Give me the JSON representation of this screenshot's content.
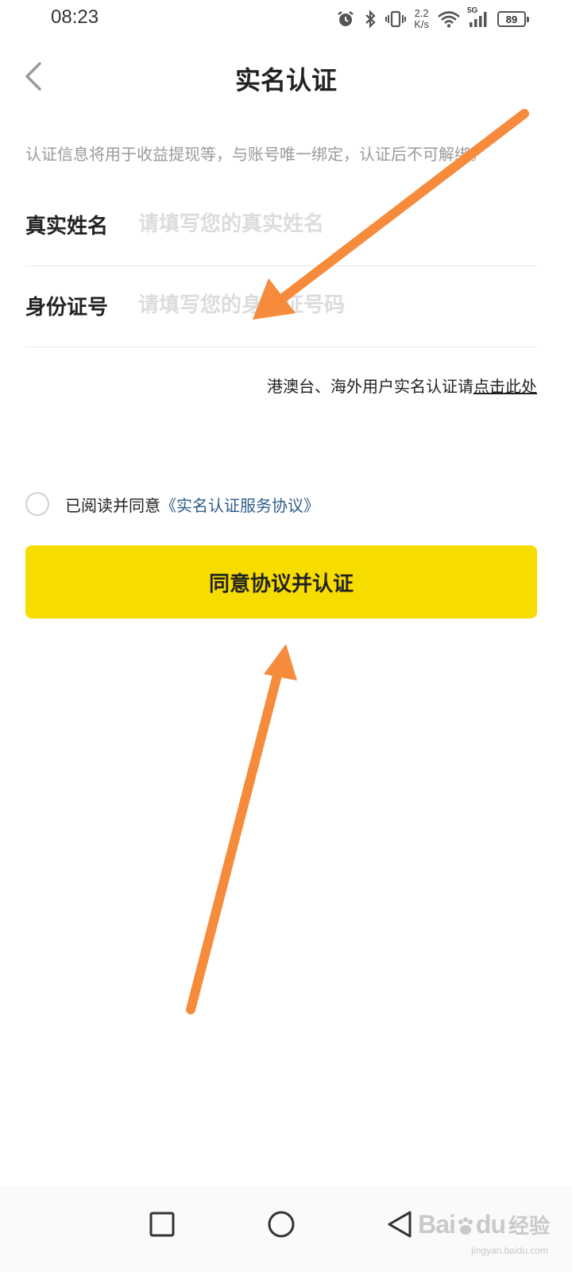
{
  "status_bar": {
    "time": "08:23",
    "net_speed_value": "2.2",
    "net_speed_unit": "K/s",
    "network_type": "5G",
    "battery": "89",
    "icons": [
      "alarm-icon",
      "bluetooth-icon",
      "vibrate-icon",
      "wifi-icon",
      "signal-icon",
      "battery-icon"
    ]
  },
  "header": {
    "title": "实名认证",
    "back_icon": "chevron-left-icon"
  },
  "notice": "认证信息将用于收益提现等，与账号唯一绑定，认证后不可解绑。",
  "form": {
    "name": {
      "label": "真实姓名",
      "placeholder": "请填写您的真实姓名",
      "value": ""
    },
    "id_number": {
      "label": "身份证号",
      "placeholder": "请填写您的身份证号码",
      "value": ""
    }
  },
  "overseas": {
    "text": "港澳台、海外用户实名认证请",
    "link": "点击此处"
  },
  "agreement": {
    "checked": false,
    "text": "已阅读并同意",
    "link": "《实名认证服务协议》"
  },
  "submit_label": "同意协议并认证",
  "annotation_color": "#f68b3c",
  "button_color": "#f7dc00",
  "link_color": "#2f5d8a",
  "system_nav": {
    "icons": [
      "recent-apps-icon",
      "home-icon",
      "back-triangle-icon"
    ]
  },
  "watermark": {
    "brand": "Bai",
    "brand_suffix": "du",
    "cn": "经验",
    "sub": "jingyan.baidu.com"
  }
}
